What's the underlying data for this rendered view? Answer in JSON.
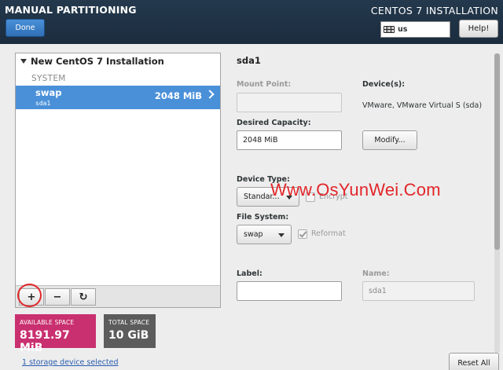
{
  "header": {
    "app_title": "MANUAL PARTITIONING",
    "done_label": "Done",
    "install_title": "CENTOS 7 INSTALLATION",
    "keyboard_layout": "us",
    "help_label": "Help!"
  },
  "partitions": {
    "installation_title": "New CentOS 7 Installation",
    "group_label": "SYSTEM",
    "items": [
      {
        "name": "swap",
        "device": "sda1",
        "size": "2048 MiB"
      }
    ],
    "toolbar": {
      "add": "+",
      "remove": "−",
      "refresh": "↻"
    }
  },
  "space": {
    "available_label": "AVAILABLE SPACE",
    "available_value": "8191.97 MiB",
    "total_label": "TOTAL SPACE",
    "total_value": "10 GiB"
  },
  "footer": {
    "storage_link": "1 storage device selected",
    "reset_label": "Reset All"
  },
  "details": {
    "title": "sda1",
    "mount_point_label": "Mount Point:",
    "mount_point_value": "",
    "desired_capacity_label": "Desired Capacity:",
    "desired_capacity_value": "2048 MiB",
    "devices_label": "Device(s):",
    "devices_text": "VMware, VMware Virtual S (sda)",
    "modify_label": "Modify...",
    "device_type_label": "Device Type:",
    "device_type_value": "Standar...",
    "encrypt_label": "Encrypt",
    "file_system_label": "File System:",
    "file_system_value": "swap",
    "reformat_label": "Reformat",
    "label_label": "Label:",
    "label_value": "",
    "name_label": "Name:",
    "name_value": "sda1"
  },
  "watermark": "Www.OsYunWei.Com",
  "colors": {
    "header_bg": "#1f3246",
    "selected_row": "#4a90d9",
    "available_bg": "#c9306f",
    "total_bg": "#5c5c5c",
    "watermark": "#e2262a"
  }
}
